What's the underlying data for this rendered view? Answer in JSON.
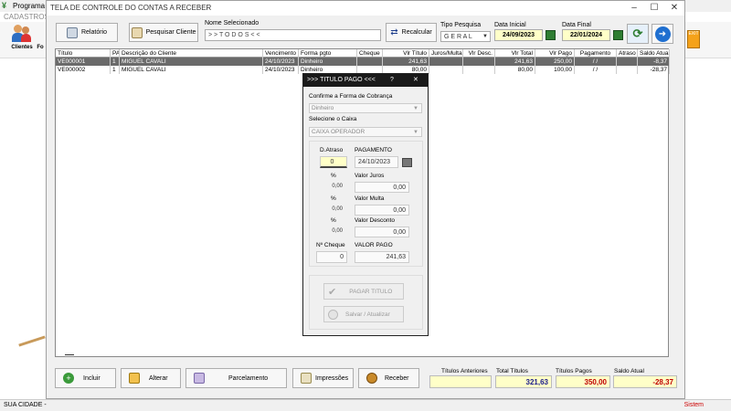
{
  "app": {
    "title": "Programa F",
    "menu_cadastros": "CADASTROS",
    "toolbar": [
      {
        "label": "Clientes"
      },
      {
        "label": "Fo"
      }
    ],
    "status_left": "SUA CIDADE -",
    "status_right": "Sistem",
    "exit_label": "EXIT"
  },
  "window": {
    "title": "TELA DE CONTROLE DO CONTAS A RECEBER",
    "relatorio": "Relatório",
    "pesquisar_cliente": "Pesquisar Cliente",
    "nome_label": "Nome Selecionado",
    "nome_value": "> > T O D O S < <",
    "recalcular": "Recalcular",
    "tipo_label": "Tipo  Pesquisa",
    "tipo_value": "G E R A L",
    "data_inicial_label": "Data Inicial",
    "data_inicial_value": "24/09/2023",
    "data_final_label": "Data Final",
    "data_final_value": "22/01/2024"
  },
  "grid": {
    "columns": [
      "Título",
      "PA",
      "Descrição do Cliente",
      "Vencimento",
      "Forma pgto",
      "Cheque",
      "Vlr Título",
      "Juros/Multa",
      "Vlr Desc.",
      "Vlr Total",
      "Vlr Pago",
      "Pagamento",
      "Atraso",
      "Saldo Atual"
    ],
    "rows": [
      [
        "VE000001",
        "1",
        "MIGUEL CAVALI",
        "24/10/2023",
        "Dinheiro",
        "",
        "241,63",
        "",
        "",
        "241,63",
        "250,00",
        "/ /",
        "",
        "-8,37"
      ],
      [
        "VE000002",
        "1",
        "MIGUEL CAVALI",
        "24/10/2023",
        "Dinheiro",
        "",
        "80,00",
        "",
        "",
        "80,00",
        "100,00",
        "/ /",
        "",
        "-28,37"
      ]
    ]
  },
  "bottom": {
    "incluir": "Incluir",
    "alterar": "Alterar",
    "parcelamento": "Parcelamento",
    "impressoes": "Impressões",
    "receber": "Receber",
    "titulos_anteriores_label": "Títulos Anteriores",
    "titulos_anteriores_value": "",
    "total_titulos_label": "Total Títulos",
    "total_titulos_value": "321,63",
    "titulos_pagos_label": "Títulos Pagos",
    "titulos_pagos_value": "350,00",
    "saldo_atual_label": "Saldo Atual",
    "saldo_atual_value": "-28,37"
  },
  "dialog": {
    "title": ">>> TITULO PAGO <<<",
    "help": "?",
    "close": "✕",
    "forma_label": "Confirme a Forma de Cobrança",
    "forma_value": "Dinheiro",
    "caixa_label": "Selecione o Caixa",
    "caixa_value": "CAIXA OPERADOR",
    "datraso_label": "D.Atraso",
    "datraso_value": "0",
    "pagamento_label": "PAGAMENTO",
    "pagamento_value": "24/10/2023",
    "pct1": "%",
    "pct1_value": "0,00",
    "juros_label": "Valor Juros",
    "juros_value": "0,00",
    "pct2": "%",
    "pct2_value": "0,00",
    "multa_label": "Valor Multa",
    "multa_value": "0,00",
    "pct3": "%",
    "pct3_value": "0,00",
    "desconto_label": "Valor Desconto",
    "desconto_value": "0,00",
    "ncheque_label": "Nº Cheque",
    "ncheque_value": "0",
    "valor_pago_label": "VALOR PAGO",
    "valor_pago_value": "241,63",
    "pagar_titulo": "PAGAR TITULO",
    "salvar": "Salvar / Atualizar"
  },
  "colors": {
    "selected_row": "#6a6a6a",
    "yellow_field": "#ffffc8",
    "total_blue": "#1a1a8c",
    "pagos_red": "#c00000",
    "dialog_title": "#1a1a1a"
  }
}
